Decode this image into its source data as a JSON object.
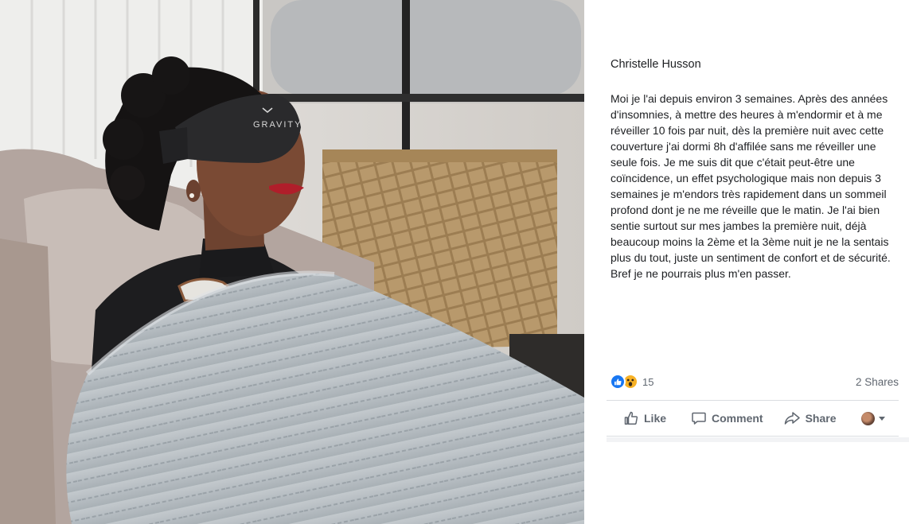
{
  "post": {
    "author": "Christelle Husson",
    "text": "Moi je l'ai depuis environ 3 semaines. Après des années d'insomnies, à mettre des heures à m'endormir et à me réveiller 10 fois par nuit, dès la première nuit avec cette couverture j'ai dormi 8h d'affilée sans me réveiller une seule fois. Je me suis dit que c'était peut-être une coïncidence, un effet psychologique mais non depuis 3 semaines je m'endors très rapidement dans un sommeil profond dont je ne me réveille que le matin. Je l'ai bien sentie surtout sur mes jambes la première nuit, déjà beaucoup moins la 2ème et la 3ème nuit je ne la sentais plus du tout, juste un sentiment de confort et de sécurité. Bref je ne pourrais plus m'en passer.",
    "photo": {
      "mask_brand": "GRAVITY",
      "icon": "photo-woman-sleep-mask-blanket"
    }
  },
  "reactions": {
    "icons": [
      "like-reaction-icon",
      "wow-reaction-icon"
    ],
    "count": "15",
    "shares": "2 Shares"
  },
  "actions": {
    "like": {
      "label": "Like",
      "icon": "thumbs-up-icon"
    },
    "comment": {
      "label": "Comment",
      "icon": "comment-bubble-icon"
    },
    "share": {
      "label": "Share",
      "icon": "share-arrow-icon"
    },
    "profile": {
      "icon": "avatar-icon",
      "caret_icon": "chevron-down-icon"
    }
  },
  "colors": {
    "like_blue": "#1877f2",
    "wow_yellow": "#f7b125",
    "muted_text": "#606770",
    "divider": "#dadde1"
  }
}
